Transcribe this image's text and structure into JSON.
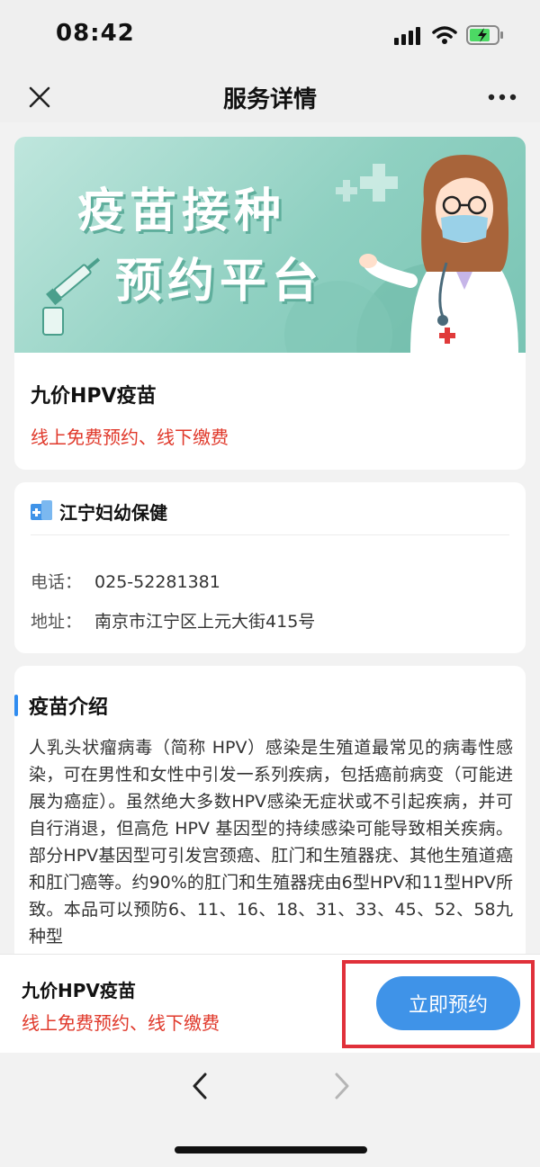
{
  "status_bar": {
    "time": "08:42"
  },
  "nav": {
    "title": "服务详情"
  },
  "banner": {
    "line1": "疫苗接种",
    "line2": "预约平台"
  },
  "product": {
    "name": "九价HPV疫苗",
    "note": "线上免费预约、线下缴费"
  },
  "clinic": {
    "name": "江宁妇幼保健",
    "phone_label": "电话：",
    "phone": "025-52281381",
    "address_label": "地址：",
    "address": "南京市江宁区上元大街415号"
  },
  "intro": {
    "title": "疫苗介绍",
    "text": "人乳头状瘤病毒（简称 HPV）感染是生殖道最常见的病毒性感染，可在男性和女性中引发一系列疾病，包括癌前病变（可能进展为癌症）。虽然绝大多数HPV感染无症状或不引起疾病，并可自行消退，但高危 HPV 基因型的持续感染可能导致相关疾病。部分HPV基因型可引发宫颈癌、肛门和生殖器疣、其他生殖道癌和肛门癌等。约90%的肛门和生殖器疣由6型HPV和11型HPV所致。本品可以预防6、11、16、18、31、33、45、52、58九种型"
  },
  "bottom_bar": {
    "name": "九价HPV疫苗",
    "note": "线上免费预约、线下缴费",
    "book_label": "立即预约"
  },
  "colors": {
    "accent": "#3f93e8",
    "warning_text": "#e0392b",
    "highlight_border": "#e0303a",
    "banner_bg": "#8fd0c1"
  },
  "icons": [
    "signal-icon",
    "wifi-icon",
    "battery-icon",
    "close-icon",
    "more-icon",
    "hospital-icon",
    "back-icon",
    "forward-icon"
  ]
}
